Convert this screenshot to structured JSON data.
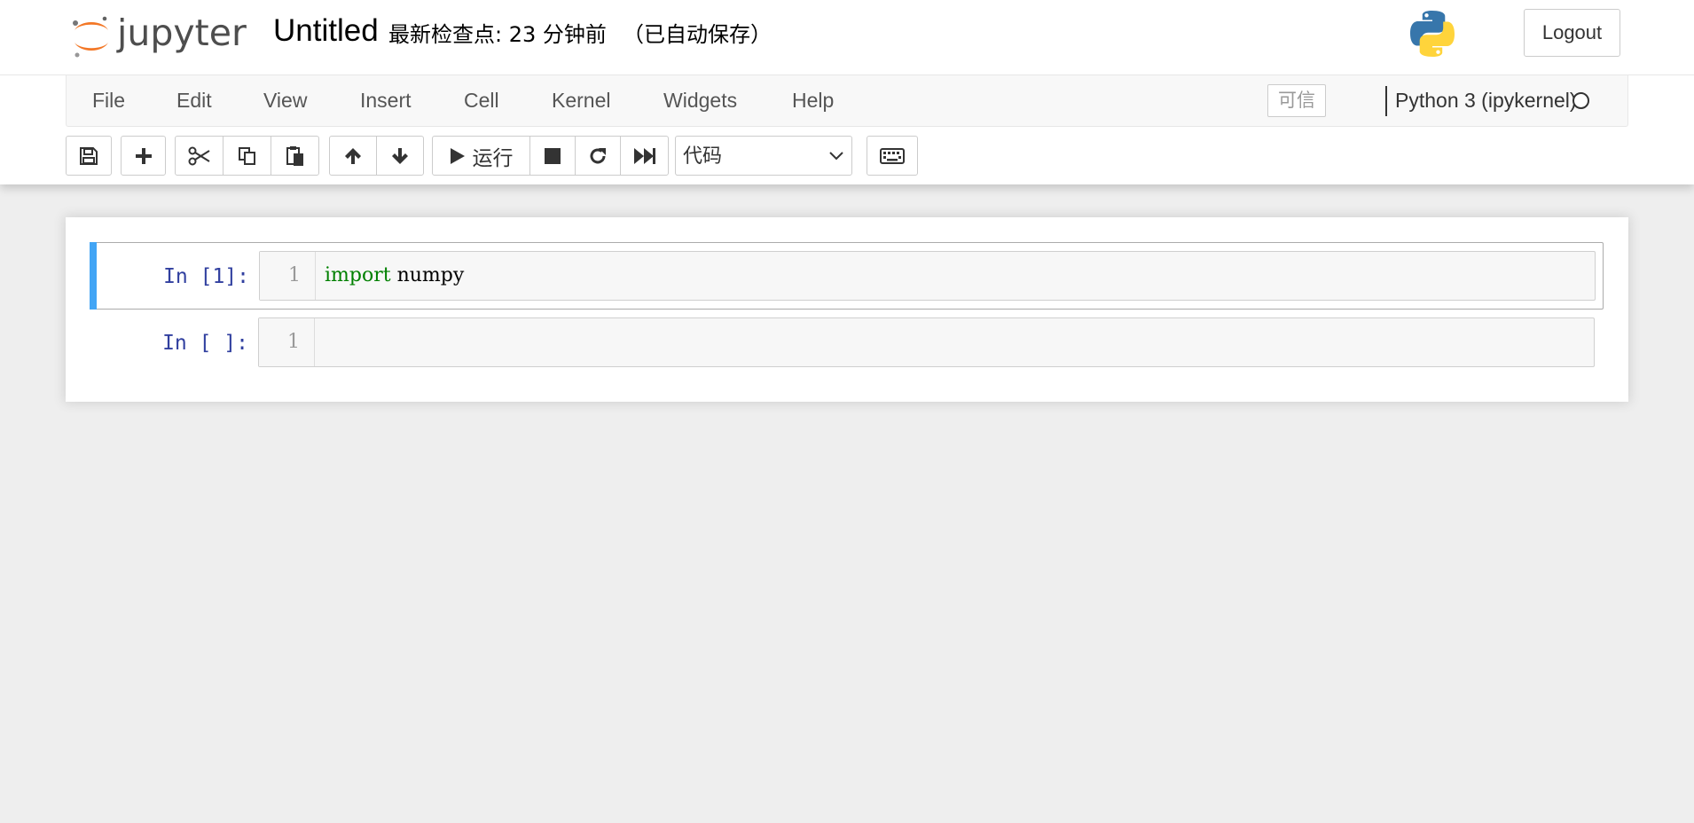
{
  "header": {
    "logo_text": "jupyter",
    "notebook_title": "Untitled",
    "checkpoint_text": "最新检查点: 23 分钟前",
    "autosave_text": "（已自动保存）",
    "logout_label": "Logout"
  },
  "menubar": {
    "items": [
      {
        "label": "File"
      },
      {
        "label": "Edit"
      },
      {
        "label": "View"
      },
      {
        "label": "Insert"
      },
      {
        "label": "Cell"
      },
      {
        "label": "Kernel"
      },
      {
        "label": "Widgets"
      },
      {
        "label": "Help"
      }
    ],
    "trusted_label": "可信",
    "kernel_name": "Python 3 (ipykernel)",
    "kernel_status": "idle"
  },
  "toolbar": {
    "run_label": "运行",
    "cell_type_value": "代码",
    "cell_type_options": [
      "代码"
    ],
    "icons": [
      "save-icon",
      "plus-icon",
      "scissors-icon",
      "copy-icon",
      "paste-icon",
      "arrow-up-icon",
      "arrow-down-icon",
      "play-icon",
      "stop-icon",
      "restart-icon",
      "fast-forward-icon",
      "keyboard-icon"
    ]
  },
  "cells": [
    {
      "prompt": "In [1]:",
      "line_number": "1",
      "code_keyword": "import",
      "code_rest": " numpy",
      "selected": true
    },
    {
      "prompt": "In [ ]:",
      "line_number": "1",
      "code_keyword": "",
      "code_rest": "",
      "selected": false
    }
  ],
  "colors": {
    "selected_bar": "#42a5f5",
    "prompt": "#303f9f",
    "keyword": "#008000",
    "page_bg": "#eeeeee",
    "jupyter_orange": "#f37726"
  }
}
